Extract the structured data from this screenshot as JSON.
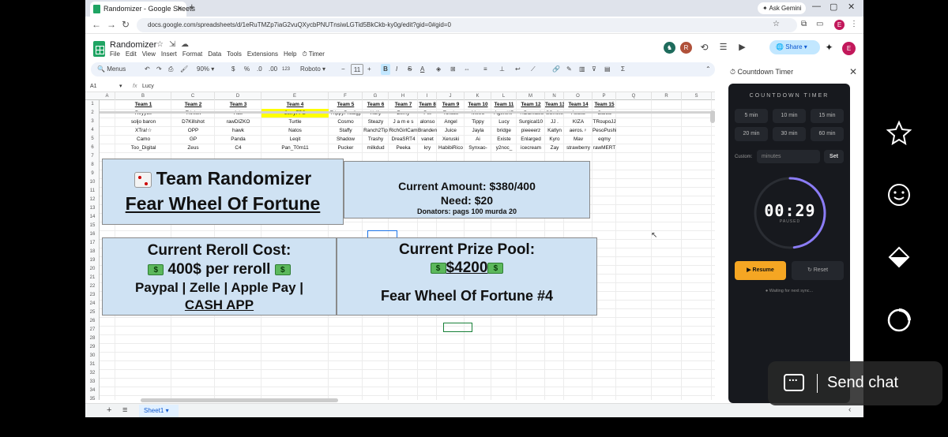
{
  "browser": {
    "tab_title": "Randomizer - Google Sheets",
    "new_tab": "+",
    "ask_gemini": "Ask Gemini",
    "url": "docs.google.com/spreadsheets/d/1eRuTMZp7iaG2vuQXycbPNUTnsiwLGTid5BkCkb-ky0g/edit?gid=0#gid=0",
    "profile_initial": "E"
  },
  "sheet_header": {
    "title": "Randomizer",
    "menus": [
      "File",
      "Edit",
      "View",
      "Insert",
      "Format",
      "Data",
      "Tools",
      "Extensions",
      "Help",
      "⏱ Timer"
    ],
    "share_label": "Share",
    "avatar_r": "R",
    "avatar_e": "E"
  },
  "toolbar": {
    "menus": "Menus",
    "zoom": "90%",
    "currency": "$",
    "percent": "%",
    "dec_less": ".0",
    "dec_more": ".00",
    "num123": "123",
    "font": "Roboto",
    "font_size": "11",
    "bold": "B",
    "italic": "I",
    "strike": "S",
    "textcolor": "A"
  },
  "formula_bar": {
    "cell_ref": "A1",
    "fx": "fx",
    "value": "Lucy"
  },
  "columns": [
    "A",
    "B",
    "C",
    "D",
    "E",
    "F",
    "G",
    "H",
    "I",
    "J",
    "K",
    "L",
    "M",
    "N",
    "O",
    "P",
    "Q",
    "R",
    "S"
  ],
  "teams": {
    "headers": [
      "Team 1",
      "Team 2",
      "Team 3",
      "Team 4",
      "Team 5",
      "Team 6",
      "Team 7",
      "Team 8",
      "Team 9",
      "Team 10",
      "Team 11",
      "Team 12",
      "Team 13",
      "Team 14",
      "Team 15"
    ],
    "rows": [
      [
        "Reyyce",
        "Trinket",
        "Ads",
        "JerryFPS",
        "TrippyProdigy",
        "Xcify",
        "Zemy",
        "Pet",
        "Torubs",
        "Metro",
        "AgentKP",
        "ᵒᵍᵍDamasio",
        "SSmike",
        "Ascxtt",
        "Garza"
      ],
      [
        "soljo baron",
        "D7Killshot",
        "rawDIZKO",
        "Turtle",
        "Cosmo",
        "Steazy",
        "J a m e s",
        "alonso",
        "Angel",
        "Tippy",
        "Lucy",
        "Surgical10",
        "JJ .",
        "KIZA",
        "TRoupoJJ"
      ],
      [
        "XTra!☆",
        "OPP",
        "hawk",
        "Natos",
        "Staffy",
        "Ranch2Tip",
        "RichGirlCam",
        "Branden",
        "Juice",
        "Jayla",
        "bridge",
        "pieeeerz",
        "Katlyn",
        "aeros.♀",
        "PesoPushin"
      ],
      [
        "Camo",
        "GP",
        "Panda",
        "Leqit",
        "Shadow",
        "Trashy",
        "DreaSRT4",
        "vanet",
        "Xeruski",
        "Ai",
        "Existe",
        "Enlarged",
        "Kyro",
        "Mav",
        "eqmy"
      ],
      [
        "Too_Digital",
        "Zeus",
        "C4",
        "Pan_T0m11",
        "Pucker",
        "milkdud",
        "Peeka",
        "kry",
        "HabibiRico",
        "Synxao-",
        "y2noc_",
        "icecream",
        "Zay",
        "strawberry",
        "rawMERT"
      ]
    ]
  },
  "randomizer_box": {
    "line1": "Team Randomizer",
    "line2": "Fear Wheel Of Fortune"
  },
  "amount_box": {
    "current": "Current Amount: $380/400",
    "need": "Need: $20",
    "donators": "Donators: pags 100 murda 20"
  },
  "reroll_box": {
    "title": "Current Reroll Cost:",
    "price": "400$ per reroll",
    "payments": "Paypal | Zelle | Apple Pay |",
    "cashapp": "CASH APP"
  },
  "prize_box": {
    "title": "Current Prize Pool:",
    "amount": "$4200",
    "event": "Fear Wheel Of Fortune #4"
  },
  "sheet_tabs": {
    "add": "+",
    "list": "≡",
    "active": "Sheet1"
  },
  "timer_panel": {
    "title": "Countdown Timer",
    "heading": "COUNTDOWN TIMER",
    "presets": [
      "5 min",
      "10 min",
      "15 min",
      "20 min",
      "30 min",
      "60 min"
    ],
    "custom_label": "Custom:",
    "custom_placeholder": "minutes",
    "set_label": "Set",
    "time": "00:29",
    "status": "PAUSED",
    "resume_label": "Resume",
    "reset_label": "Reset",
    "sync_text": "Waiting for next sync...",
    "progress_fraction": 0.48
  },
  "overlay": {
    "send_chat": "Send chat"
  },
  "colors": {
    "accent": "#f5a623",
    "sheets_green": "#1fa463",
    "cell_blue": "#cfe2f3",
    "highlight": "#ffff00"
  }
}
